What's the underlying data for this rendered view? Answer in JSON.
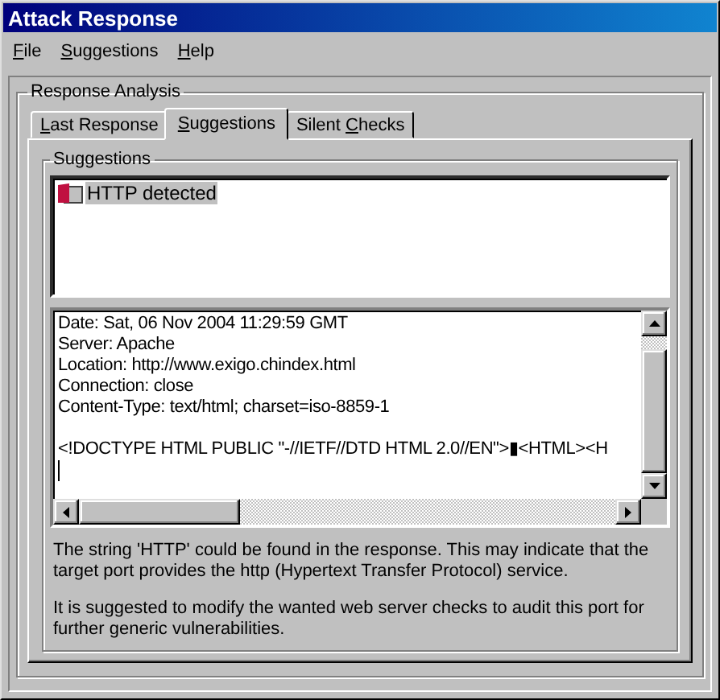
{
  "window": {
    "title": "Attack Response"
  },
  "menu": [
    {
      "access_key": "F",
      "rest": "ile"
    },
    {
      "access_key": "S",
      "rest": "uggestions"
    },
    {
      "access_key": "H",
      "rest": "elp"
    }
  ],
  "group": {
    "title": "Response Analysis"
  },
  "tabs": [
    {
      "access_key": "L",
      "rest": "ast Response",
      "selected": false
    },
    {
      "access_key": "S",
      "rest": "uggestions",
      "selected": true
    },
    {
      "before": "Silent ",
      "access_key": "C",
      "rest": "hecks",
      "selected": false
    }
  ],
  "suggestions": {
    "title": "Suggestions",
    "items": [
      {
        "label": "HTTP detected",
        "selected": true
      }
    ]
  },
  "response": {
    "headers": [
      "Date: Sat, 06 Nov 2004 11:29:59 GMT",
      "Server: Apache",
      "Location: http://www.exigo.chindex.html",
      "Connection: close",
      "Content-Type: text/html; charset=iso-8859-1"
    ],
    "body": [
      "<!DOCTYPE HTML PUBLIC \"-//IETF//DTD HTML 2.0//EN\">▮<HTML><H"
    ]
  },
  "description": [
    "The string 'HTTP' could be found in the response. This may indicate that the target port provides the http (Hypertext Transfer Protocol) service.",
    "It is suggested to modify the wanted web server checks to audit this port for further generic vulnerabilities."
  ]
}
